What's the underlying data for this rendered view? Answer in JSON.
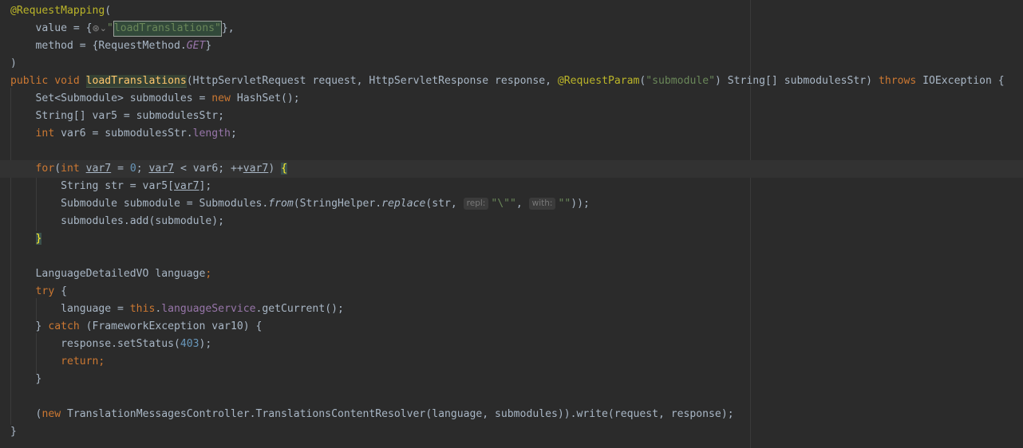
{
  "editor": {
    "tokens": {
      "request_mapping_ann": "@RequestMapping",
      "open_paren": "(",
      "value_key": "value = {",
      "url_icon": "⊛⌄",
      "value_string_pre": "\"",
      "value_string_main": "loadTranslation",
      "value_string_post": "s\"",
      "value_close": "},",
      "method_key": "method = {RequestMethod.",
      "method_get": "GET",
      "method_close": "}",
      "close_paren": ")",
      "public": "public",
      "void": "void",
      "method_name": "loadTranslations",
      "sig_mid": "(HttpServletRequest request, HttpServletResponse response, ",
      "request_param_ann": "@RequestParam",
      "request_param_open": "(",
      "submodule_str": "\"submodule\"",
      "sig_end": ") String[] submodulesStr) ",
      "throws": "throws",
      "ioexception": " IOException {",
      "set_decl": "Set<Submodule> submodules = ",
      "new": "new",
      "hashset": " HashSet();",
      "string_arr_decl": "String[] var5 = submodulesStr;",
      "int": "int",
      "var6_decl": " var6 = submodulesStr.",
      "length": "length",
      "semi": ";",
      "for": "for",
      "for_open": "(",
      "var7": "var7",
      "eq": " = ",
      "zero": "0",
      "lt_sep": "; ",
      "lt": " < var6; ++",
      "for_close": ") ",
      "open_brace": "{",
      "str_decl": "String str = var5[",
      "bracket_close": "];",
      "submodule_decl": "Submodule submodule = Submodules.",
      "from": "from",
      "string_helper": "(StringHelper.",
      "replace": "replace",
      "replace_open": "(str, ",
      "hint_repl": "repl:",
      "quote_str": "\"\\\"\"",
      "comma_sp": ", ",
      "hint_with": "with:",
      "empty_str": "\"\"",
      "close_call": "));",
      "submodules_add": "submodules.add(submodule);",
      "close_brace": "}",
      "lang_decl": "LanguageDetailedVO language",
      "try": "try",
      "try_brace": " {",
      "lang_assign": "language = ",
      "this": "this",
      "dot": ".",
      "language_service": "languageService",
      "get_current": ".getCurrent();",
      "catch_open": "} ",
      "catch": "catch",
      "catch_rest": " (FrameworkException var10) {",
      "set_status": "response.setStatus(",
      "status_code": "403",
      "close_paren_semi": ");",
      "return": "return",
      "new_paren": "(",
      "resolver": " TranslationMessagesController.TranslationsContentResolver(language, submodules)).write(request, response);"
    }
  }
}
